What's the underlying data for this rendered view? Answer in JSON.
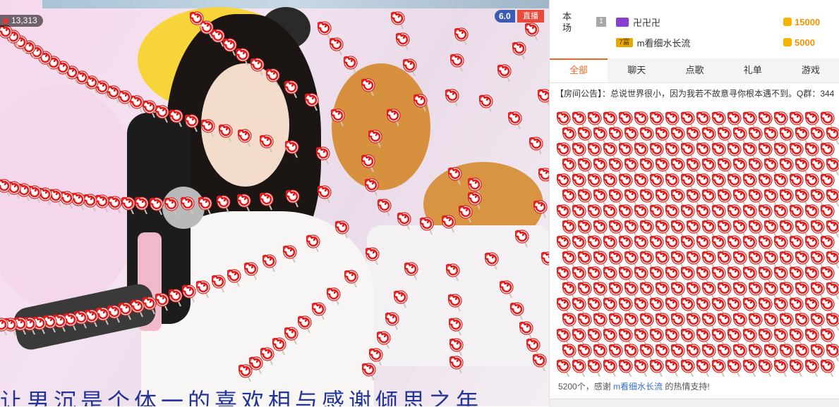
{
  "stream": {
    "viewer_count": "13,313",
    "count_tag": "6.0",
    "live_label": "直播",
    "danmaku_text": "让男沉是个体一的喜欢相与感谢倾思之年"
  },
  "rank": {
    "title": "本场",
    "rows": [
      {
        "num": "1",
        "level": "",
        "name": "卍卍卍",
        "coins": "15000",
        "level_color": "#8b3fd1"
      },
      {
        "num": "2",
        "level": "7富",
        "name": "m看细水长流",
        "coins": "5000",
        "level_color": "#e7a800"
      }
    ]
  },
  "tabs": [
    "全部",
    "聊天",
    "点歌",
    "礼单",
    "游戏"
  ],
  "notice": "【房间公告】：总说世界很小，因为我若不故意寻你根本遇不到。Q群：344",
  "thanks": {
    "prefix": "5200个，感谢",
    "user": "m看细水长流",
    "suffix": "的热情支持!"
  },
  "colors": {
    "accent": "#f5661e",
    "lollipop_red": "#e31b1b",
    "coin_gold": "#f19400"
  }
}
